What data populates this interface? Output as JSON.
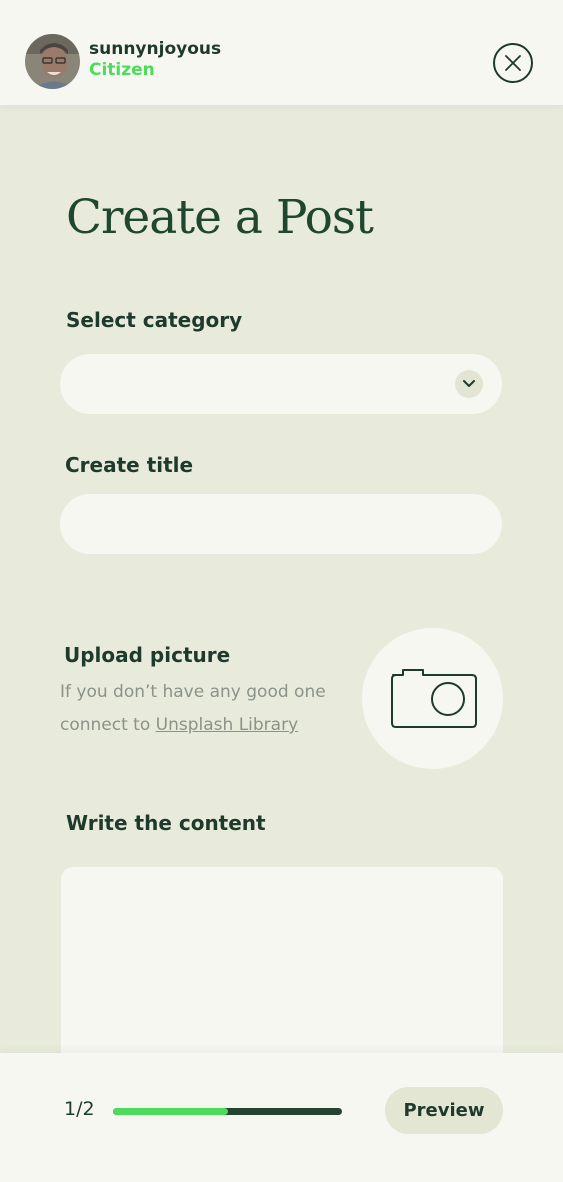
{
  "header": {
    "username": "sunnynjoyous",
    "role": "Citizen",
    "role_color": "#4cdb5a",
    "avatar_icon": "user-avatar",
    "close_icon": "close-icon"
  },
  "page": {
    "title": "Create a Post"
  },
  "form": {
    "category": {
      "label": "Select category",
      "value": "",
      "icon": "chevron-down-icon"
    },
    "title": {
      "label": "Create title",
      "value": ""
    },
    "upload": {
      "label": "Upload picture",
      "hint_prefix": "If you don’t have any good one connect to ",
      "link_text": "Unsplash Library",
      "icon": "camera-icon"
    },
    "content": {
      "label": "Write the content",
      "value": ""
    }
  },
  "footer": {
    "step": "1/2",
    "progress": 0.5,
    "progress_color": "#4cdb5a",
    "preview_label": "Preview"
  }
}
